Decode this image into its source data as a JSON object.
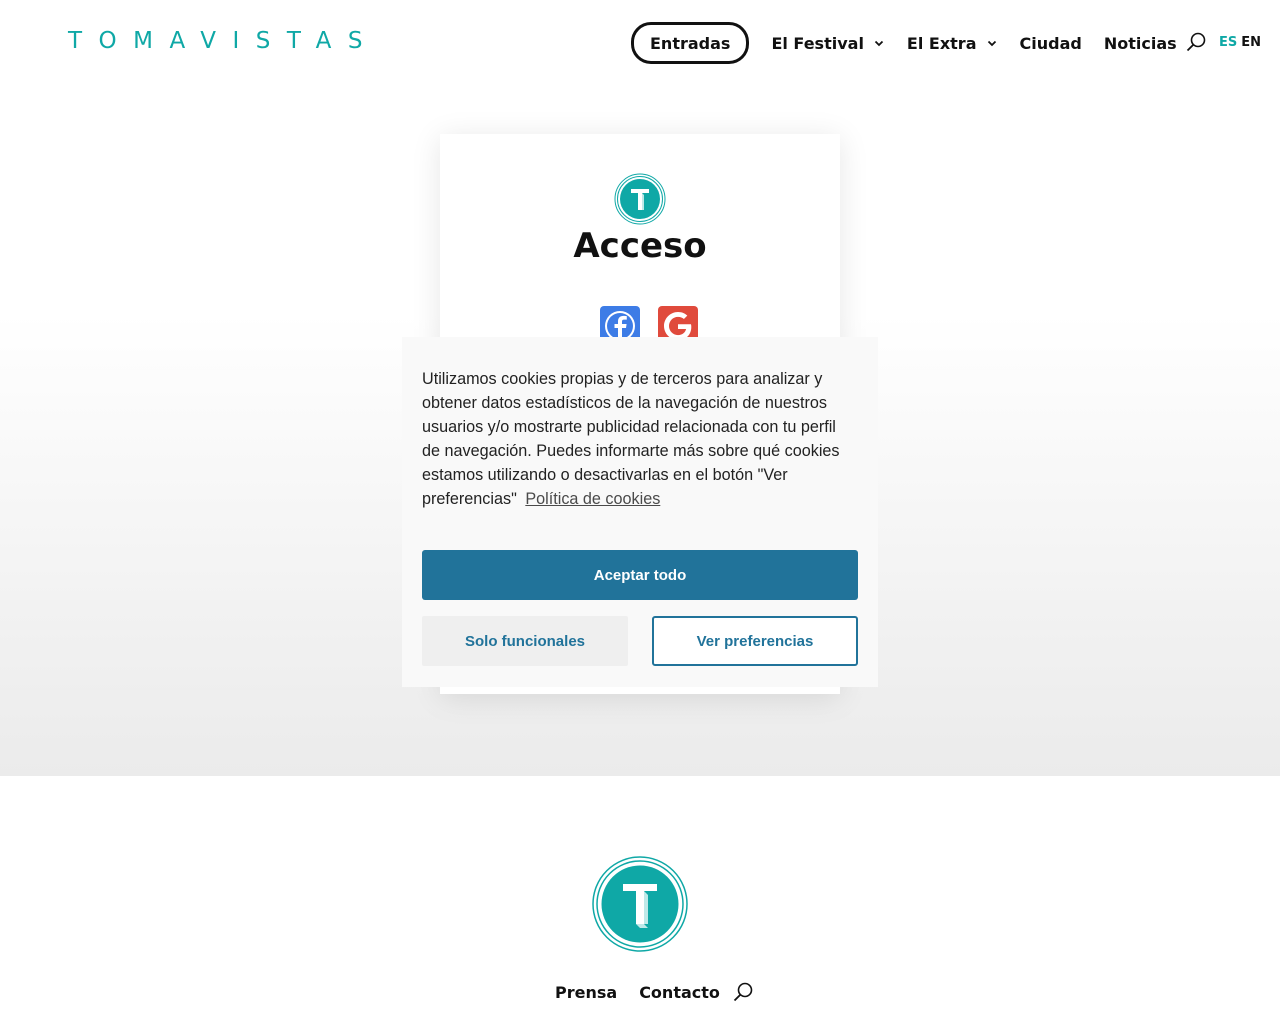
{
  "header": {
    "logo_text": "TOMAVISTAS",
    "nav": {
      "entradas": "Entradas",
      "festival": "El Festival",
      "extra": "El Extra",
      "ciudad": "Ciudad",
      "noticias": "Noticias"
    },
    "lang": {
      "es": "ES",
      "en": "EN"
    }
  },
  "login_card": {
    "title": "Acceso",
    "social_icons": [
      "facebook-icon",
      "google-icon"
    ]
  },
  "cookie_banner": {
    "text": "Utilizamos cookies propias y de terceros para analizar y obtener datos estadísticos de la navegación de nuestros usuarios y/o mostrarte publicidad relacionada con tu perfil de navegación. Puedes informarte más sobre qué cookies estamos utilizando o desactivarlas en el botón \"Ver preferencias\"",
    "policy_link": "Política de cookies",
    "accept_all": "Aceptar todo",
    "only_functional": "Solo funcionales",
    "preferences": "Ver preferencias"
  },
  "footer": {
    "prensa": "Prensa",
    "contacto": "Contacto"
  },
  "colors": {
    "brand_teal": "#0fa8a6",
    "cookie_blue": "#21739a"
  }
}
